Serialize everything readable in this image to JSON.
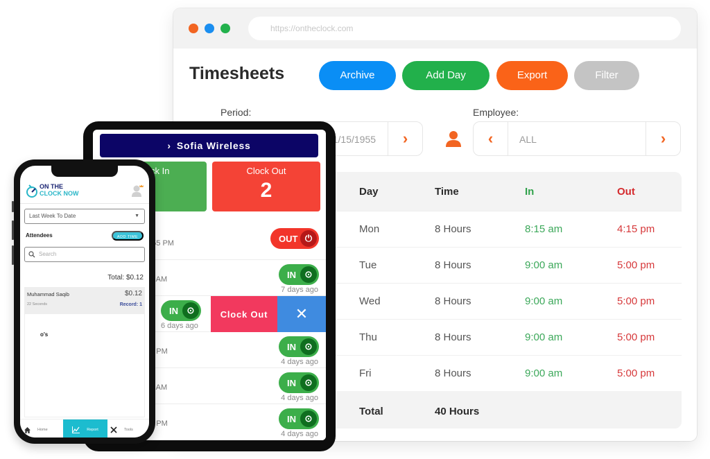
{
  "browser": {
    "url": "https://ontheclock.com",
    "window_dots": [
      "close",
      "minimize",
      "maximize"
    ]
  },
  "timesheets": {
    "title": "Timesheets",
    "actions": {
      "archive": "Archive",
      "add_day": "Add Day",
      "export": "Export",
      "filter": "Filter"
    },
    "period": {
      "label": "Period:",
      "value": "11/15/1955"
    },
    "employee": {
      "label": "Employee:",
      "value": "ALL"
    },
    "table": {
      "headers": {
        "day": "Day",
        "time": "Time",
        "in": "In",
        "out": "Out"
      },
      "rows": [
        {
          "day": "Mon",
          "time": "8 Hours",
          "in": "8:15 am",
          "out": "4:15 pm"
        },
        {
          "day": "Tue",
          "time": "8 Hours",
          "in": "9:00 am",
          "out": "5:00 pm"
        },
        {
          "day": "Wed",
          "time": "8 Hours",
          "in": "9:00 am",
          "out": "5:00 pm"
        },
        {
          "day": "Thu",
          "time": "8 Hours",
          "in": "9:00 am",
          "out": "5:00 pm"
        },
        {
          "day": "Fri",
          "time": "8 Hours",
          "in": "9:00 am",
          "out": "5:00 pm"
        }
      ],
      "total": {
        "label": "Total",
        "time": "40 Hours"
      }
    },
    "colors": {
      "archive": "#0a8ef5",
      "add_day": "#22b04b",
      "export": "#fa6318",
      "filter": "#c4c4c4",
      "in": "#3ca85a",
      "out": "#d6383a",
      "accent": "#f26522"
    }
  },
  "tablet": {
    "company": "Sofia Wireless",
    "clock_in": {
      "label": "Clock In",
      "count": ""
    },
    "clock_out": {
      "label": "Clock Out",
      "count": "2"
    },
    "entries": [
      {
        "time": "2:55 PM",
        "status": "OUT",
        "ago": ""
      },
      {
        "time": "44 AM",
        "status": "IN",
        "ago": "7 days ago"
      },
      {
        "time": "",
        "status": "IN",
        "ago": "6 days ago",
        "swipe_action": "Clock Out",
        "swipe_close": "✕"
      },
      {
        "time": "47 PM",
        "status": "IN",
        "ago": "4 days ago"
      },
      {
        "time": "00 AM",
        "status": "IN",
        "ago": "4 days ago"
      },
      {
        "time": "00 PM",
        "status": "IN",
        "ago": "4 days ago"
      }
    ]
  },
  "phone": {
    "logo": {
      "line1": "ON THE",
      "line2": "CLOCK NOW"
    },
    "range": "Last Week To Date",
    "attendees_label": "Attendees",
    "add_time": "ADD TIME",
    "search_placeholder": "Search",
    "total": "Total: $0.12",
    "attendee": {
      "name": "Muhammad Saqib",
      "duration": "22 Seconds",
      "amount": "$0.12",
      "record": "Record: 1"
    },
    "detail_text": "o's",
    "nav": {
      "home": "Home",
      "report": "Report",
      "tools": "Tools"
    }
  }
}
